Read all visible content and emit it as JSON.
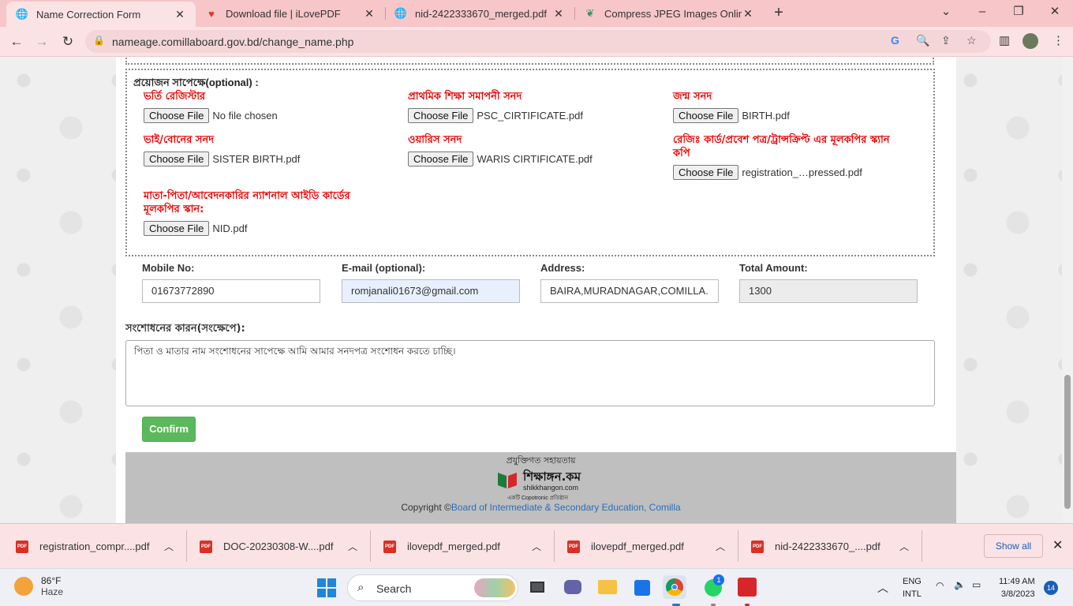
{
  "browser": {
    "tabs": [
      {
        "title": "Name Correction Form",
        "icon": "globe-icon"
      },
      {
        "title": "Download file | iLovePDF",
        "icon": "heart-icon"
      },
      {
        "title": "nid-2422333670_merged.pdf",
        "icon": "globe-icon"
      },
      {
        "title": "Compress JPEG Images Online",
        "icon": "leaf-icon"
      }
    ],
    "close_glyph": "✕",
    "new_tab_glyph": "+",
    "url": "nameage.comillaboard.gov.bd/change_name.php"
  },
  "form": {
    "optional_heading": "প্রয়োজন সাপেক্ষে(optional) :",
    "choose_file_label": "Choose File",
    "files": [
      {
        "label": "ভর্তি রেজিস্টার",
        "file": "No file chosen"
      },
      {
        "label": "প্রাথমিক শিক্ষা সমাপনী সনদ",
        "file": "PSC_CIRTIFICATE.pdf"
      },
      {
        "label": "জন্ম সনদ",
        "file": "BIRTH.pdf"
      },
      {
        "label": "ভাই/বোনের সনদ",
        "file": "SISTER BIRTH.pdf"
      },
      {
        "label": "ওয়ারিস সনদ",
        "file": "WARIS CIRTIFICATE.pdf"
      },
      {
        "label": "রেজিঃ কার্ড/প্রবেশ পত্র/ট্রান্সক্রিপ্ট এর মূলকপির স্ক্যান কপি",
        "file": "registration_…pressed.pdf"
      },
      {
        "label": "মাতা-পিতা/আবেদনকারির ন্যাশনাল আইডি কার্ডের মূলকপির স্কান:",
        "file": "NID.pdf"
      }
    ],
    "mobile": {
      "label": "Mobile No:",
      "value": "01673772890"
    },
    "email": {
      "label": "E-mail (optional):",
      "value": "romjanali01673@gmail.com"
    },
    "address": {
      "label": "Address:",
      "value": "BAIRA,MURADNAGAR,COMILLA."
    },
    "total": {
      "label": "Total Amount:",
      "value": "1300"
    },
    "reason_label": "সংশোধনের কারন(সংক্ষেপে):",
    "reason_value": "পিতা ও  মাতার নাম সংশোধনের সাপেক্ষে আমি আমার সনদপত্র সংশোধন করতে চাচ্ছি।",
    "confirm_label": "Confirm"
  },
  "footer": {
    "powered": "প্রযুক্তিগত সহায়তায়",
    "logo_name": "শিক্ষাঙ্গন.কম",
    "logo_domain": "shikkhangon.com",
    "logo_tag": "একটি Copotronic প্রতিষ্ঠান",
    "copyright": "Copyright ©",
    "board": "Board of Intermediate & Secondary Education, Comilla",
    "link_color": "#2a6ebb"
  },
  "downloads": {
    "items": [
      "registration_compr....pdf",
      "DOC-20230308-W....pdf",
      "ilovepdf_merged.pdf",
      "ilovepdf_merged.pdf",
      "nid-2422333670_....pdf"
    ],
    "show_all": "Show all"
  },
  "taskbar": {
    "temp": "86°F",
    "weather": "Haze",
    "search": "Search",
    "whatsapp_badge": "1",
    "lang1": "ENG",
    "lang2": "INTL",
    "time": "11:49 AM",
    "date": "3/8/2023",
    "notifications": "14"
  }
}
